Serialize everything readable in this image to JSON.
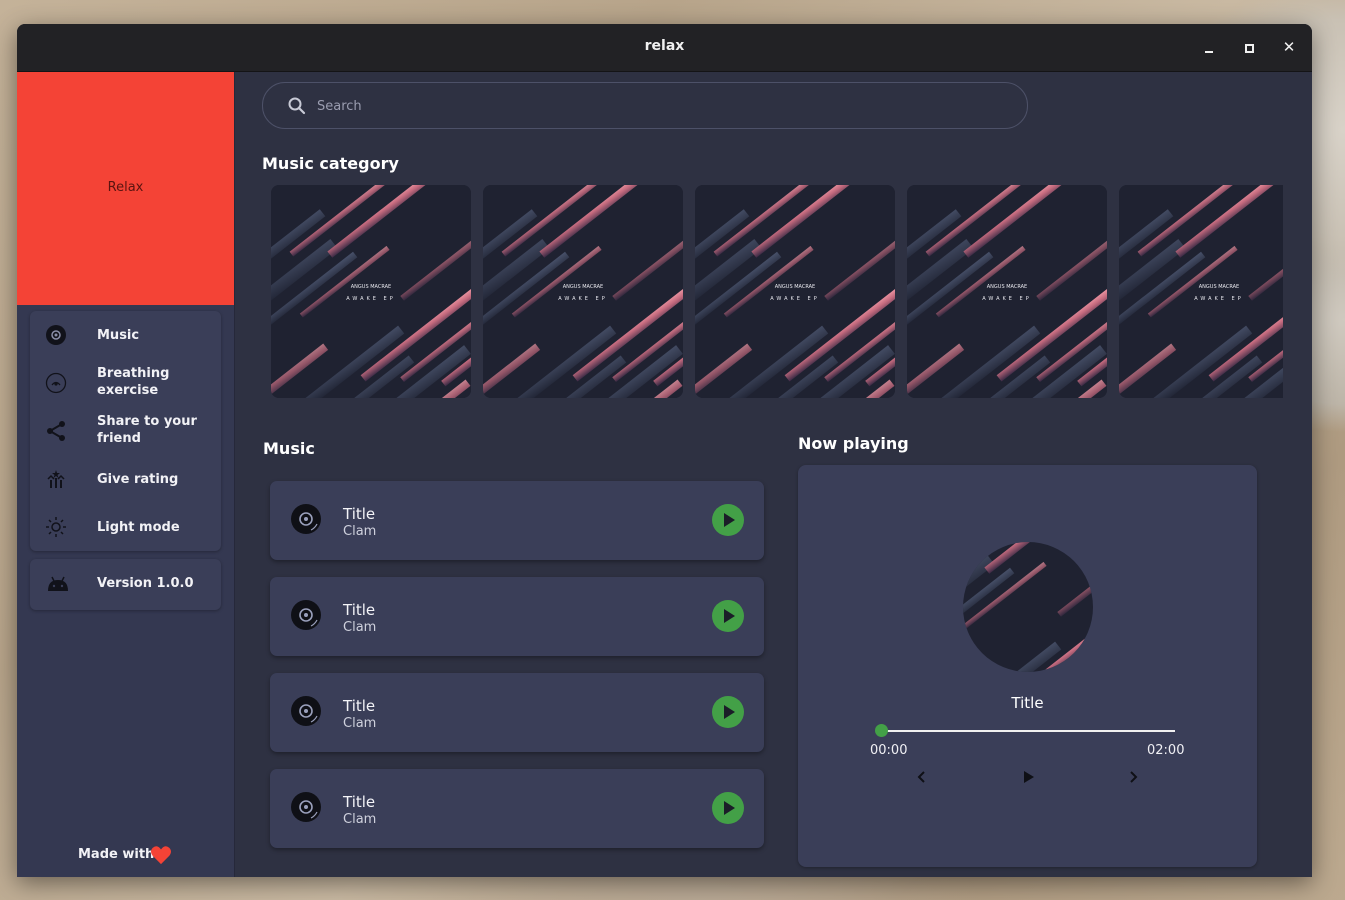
{
  "window": {
    "title": "relax"
  },
  "sidebar": {
    "header_text": "Relax",
    "menu": [
      {
        "label": "Music",
        "icon": "disc-icon"
      },
      {
        "label": "Breathing exercise",
        "icon": "breathing-icon"
      },
      {
        "label": "Share to your friend",
        "icon": "share-icon"
      },
      {
        "label": "Give rating",
        "icon": "rating-icon"
      },
      {
        "label": "Light mode",
        "icon": "sun-icon"
      }
    ],
    "version": {
      "label": "Version 1.0.0",
      "icon": "android-icon"
    },
    "footer": {
      "text": "Made with",
      "icon": "heart-icon"
    }
  },
  "search": {
    "placeholder": "Search"
  },
  "categories": {
    "title": "Music category",
    "items": [
      {
        "artist": "ANGUS MACRAE",
        "album": "AWAKE EP"
      },
      {
        "artist": "ANGUS MACRAE",
        "album": "AWAKE EP"
      },
      {
        "artist": "ANGUS MACRAE",
        "album": "AWAKE EP"
      },
      {
        "artist": "ANGUS MACRAE",
        "album": "AWAKE EP"
      },
      {
        "artist": "ANGUS MACRAE",
        "album": "AWAKE EP"
      }
    ]
  },
  "music": {
    "title": "Music",
    "songs": [
      {
        "title": "Title",
        "artist": "Clam"
      },
      {
        "title": "Title",
        "artist": "Clam"
      },
      {
        "title": "Title",
        "artist": "Clam"
      },
      {
        "title": "Title",
        "artist": "Clam"
      }
    ]
  },
  "now_playing": {
    "heading": "Now playing",
    "title": "Title",
    "time_current": "00:00",
    "time_total": "02:00",
    "progress": 0
  },
  "colors": {
    "accent": "#f44336",
    "play": "#43a047",
    "background": "#2e3142",
    "card": "#3a3e58"
  }
}
